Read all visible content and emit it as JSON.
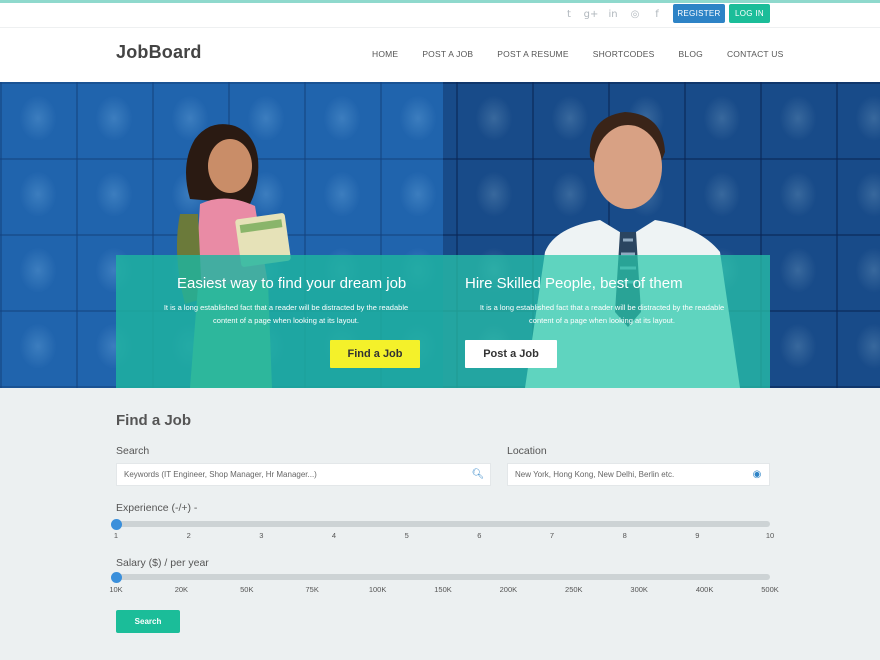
{
  "topbar": {
    "social_icons": [
      {
        "name": "twitter-icon",
        "glyph": "t"
      },
      {
        "name": "google-plus-icon",
        "glyph": "g+"
      },
      {
        "name": "linkedin-icon",
        "glyph": "in"
      },
      {
        "name": "dribbble-icon",
        "glyph": "◎"
      },
      {
        "name": "facebook-icon",
        "glyph": "f"
      }
    ],
    "register_label": "REGISTER",
    "login_label": "LOG IN"
  },
  "header": {
    "logo": "JobBoard",
    "nav": [
      "HOME",
      "POST A JOB",
      "POST A RESUME",
      "SHORTCODES",
      "BLOG",
      "CONTACT US"
    ]
  },
  "hero": {
    "left": {
      "title": "Easiest way to find your dream job",
      "text_line1": "It is a long established fact that a reader will be distracted by the readable",
      "text_line2": "content of a page when looking at its layout.",
      "button": "Find a Job"
    },
    "right": {
      "title": "Hire Skilled People, best of them",
      "text_line1": "It is a long established fact that a reader will be distracted by the readable",
      "text_line2": "content of a page when looking at its layout.",
      "button": "Post a Job"
    }
  },
  "find_job": {
    "title": "Find a Job",
    "search_label": "Search",
    "search_placeholder": "Keywords (IT Engineer, Shop Manager, Hr Manager...)",
    "location_label": "Location",
    "location_placeholder": "New York, Hong Kong, New Delhi, Berlin etc.",
    "experience_label": "Experience (-/+) -",
    "experience_ticks": [
      "1",
      "2",
      "3",
      "4",
      "5",
      "6",
      "7",
      "8",
      "9",
      "10"
    ],
    "experience_value": "1",
    "salary_label": "Salary ($) / per year",
    "salary_ticks": [
      "10K",
      "20K",
      "50K",
      "75K",
      "100K",
      "150K",
      "200K",
      "250K",
      "300K",
      "400K",
      "500K"
    ],
    "salary_value": "10K",
    "search_button": "Search"
  },
  "colors": {
    "accent_green": "#1bbd99",
    "accent_blue": "#2d83c6",
    "accent_yellow": "#f4f12a"
  }
}
